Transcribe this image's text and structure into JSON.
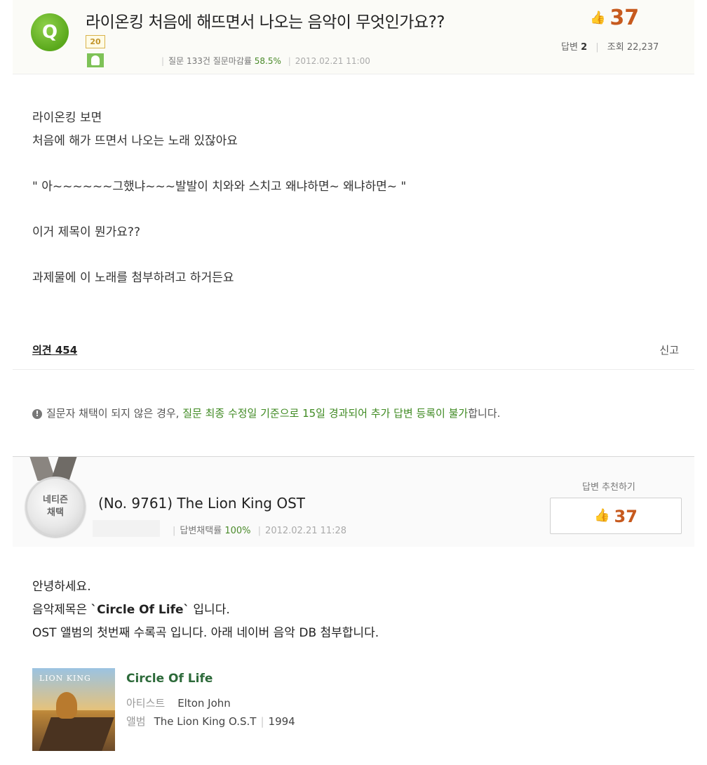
{
  "question": {
    "badge": "Q",
    "title": "라이온킹 처음에 해뜨면서 나오는 음악이 무엇인가요??",
    "level": "20",
    "meta_prefix": "질문 133건 질문마감률",
    "close_rate": "58.5%",
    "date": "2012.02.21 11:00",
    "likes": "37",
    "answers_label": "답변",
    "answers_count": "2",
    "views_label": "조회",
    "views_count": "22,237",
    "body": [
      "라이온킹 보면",
      "처음에 해가 뜨면서 나오는 노래 있잖아요",
      "",
      "\" 아~~~~~~그했냐~~~발발이 치와와   스치고    왜냐하면~ 왜냐하면~ \"",
      "",
      "이거 제목이 뭔가요??",
      "",
      "과제물에 이 노래를 첨부하려고 하거든요"
    ]
  },
  "opinion_label": "의견 454",
  "report_label": "신고",
  "notice": {
    "prefix": "질문자 채택이 되지 않은 경우, ",
    "highlight": "질문 최종 수정일 기준으로 15일 경과되어 추가 답변 등록이 불가",
    "suffix": "합니다."
  },
  "answer": {
    "medal_line1": "네티즌",
    "medal_line2": "채택",
    "title": "(No. 9761) The Lion King OST",
    "meta_prefix": "답변채택률",
    "adopt_rate": "100%",
    "date": "2012.02.21 11:28",
    "recommend_label": "답변 추천하기",
    "likes": "37",
    "line1": "안녕하세요.",
    "line2_prefix": "음악제목은 ",
    "line2_bold": "`Circle Of Life`",
    "line2_suffix": " 입니다.",
    "line3": "OST 앨범의 첫번째 수록곡 입니다. 아래 네이버 음악 DB 첨부합니다."
  },
  "music": {
    "album_logo": "LION KING",
    "song_title": "Circle Of Life",
    "artist_label": "아티스트",
    "artist": "Elton John",
    "album_label": "앨범",
    "album": "The Lion King O.S.T",
    "year": "1994"
  },
  "colors": {
    "accent_green": "#3f8a22",
    "like_orange": "#c75a1e",
    "badge_green": "#5aa81c"
  }
}
